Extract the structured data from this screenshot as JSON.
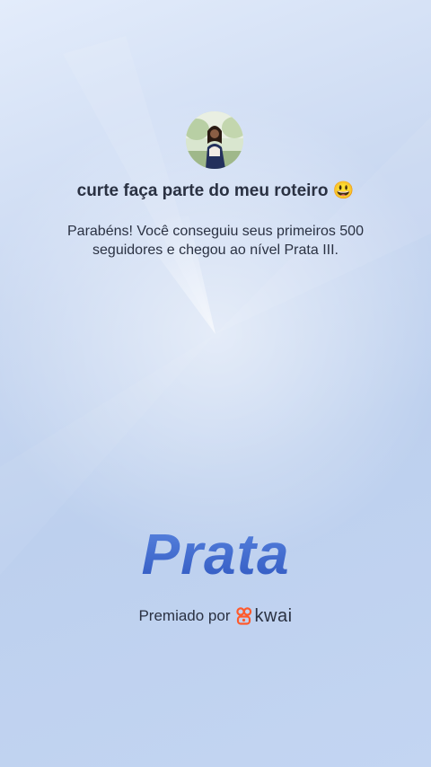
{
  "profile": {
    "avatar_icon": "user-avatar-photo",
    "username": "curte faça parte do meu roteiro 😃"
  },
  "achievement": {
    "message": "Parabéns! Você conseguiu seus primeiros 500 seguidores e chegou ao nível Prata III.",
    "level_title": "Prata"
  },
  "sponsor": {
    "awarded_label": "Premiado por",
    "brand_name": "kwai",
    "brand_icon": "kwai-logo-icon",
    "brand_color": "#ff5a2c"
  },
  "colors": {
    "level_title": "#3e67c9",
    "text": "#2a3142"
  }
}
